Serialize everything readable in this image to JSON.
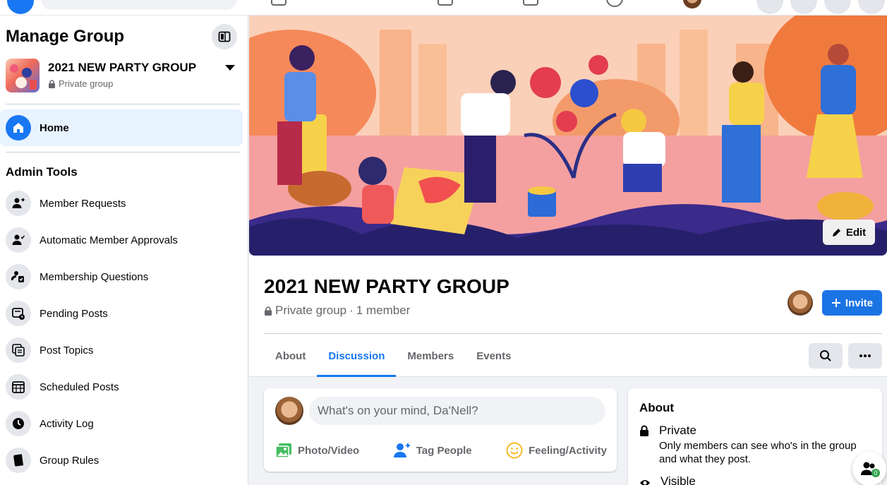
{
  "sidebar": {
    "title": "Manage Group",
    "group": {
      "name": "2021 NEW PARTY GROUP",
      "privacy": "Private group"
    },
    "home_label": "Home",
    "admin_title": "Admin Tools",
    "admin_items": [
      {
        "label": "Member Requests",
        "icon": "member-requests-icon"
      },
      {
        "label": "Automatic Member Approvals",
        "icon": "auto-approvals-icon"
      },
      {
        "label": "Membership Questions",
        "icon": "membership-questions-icon"
      },
      {
        "label": "Pending Posts",
        "icon": "pending-posts-icon"
      },
      {
        "label": "Post Topics",
        "icon": "post-topics-icon"
      },
      {
        "label": "Scheduled Posts",
        "icon": "calendar-icon"
      },
      {
        "label": "Activity Log",
        "icon": "clock-icon"
      },
      {
        "label": "Group Rules",
        "icon": "rules-icon"
      }
    ]
  },
  "cover": {
    "edit_label": "Edit"
  },
  "header": {
    "title": "2021 NEW PARTY GROUP",
    "privacy": "Private group",
    "members": "1 member",
    "invite_label": "Invite"
  },
  "tabs": [
    {
      "label": "About",
      "active": false
    },
    {
      "label": "Discussion",
      "active": true
    },
    {
      "label": "Members",
      "active": false
    },
    {
      "label": "Events",
      "active": false
    }
  ],
  "composer": {
    "placeholder": "What's on your mind, Da'Nell?",
    "actions": [
      "Photo/Video",
      "Tag People",
      "Feeling/Activity"
    ]
  },
  "about": {
    "title": "About",
    "private_heading": "Private",
    "private_desc": "Only members can see who's in the group and what they post.",
    "visible_heading": "Visible"
  },
  "float_badge": "0",
  "colors": {
    "accent": "#1877f2",
    "photo": "#45bd62",
    "tag": "#1877f2",
    "feeling": "#f7b928"
  }
}
